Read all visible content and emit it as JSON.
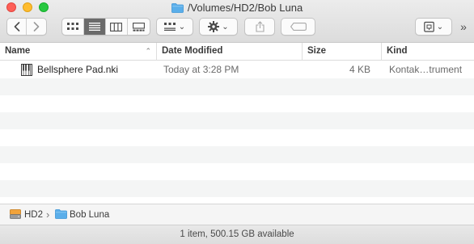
{
  "window": {
    "title": "/Volumes/HD2/Bob Luna"
  },
  "toolbar": {
    "overflow_label": "»",
    "view_modes": [
      "icon-view",
      "list-view",
      "column-view",
      "gallery-view"
    ],
    "active_view": "list-view"
  },
  "columns": {
    "name": "Name",
    "date": "Date Modified",
    "size": "Size",
    "kind": "Kind"
  },
  "files": [
    {
      "name": "Bellsphere Pad.nki",
      "date": "Today at 3:28 PM",
      "size": "4 KB",
      "kind": "Kontak…trument",
      "icon": "keyboard-instrument-icon"
    }
  ],
  "pathbar": {
    "items": [
      "HD2",
      "Bob Luna"
    ]
  },
  "status": {
    "text": "1 item, 500.15 GB available"
  },
  "colors": {
    "close": "#fe5f57",
    "minimize": "#febc2e",
    "maximize": "#28c840",
    "folder": "#5aaeea",
    "active_segment": "#6b6b6b"
  }
}
